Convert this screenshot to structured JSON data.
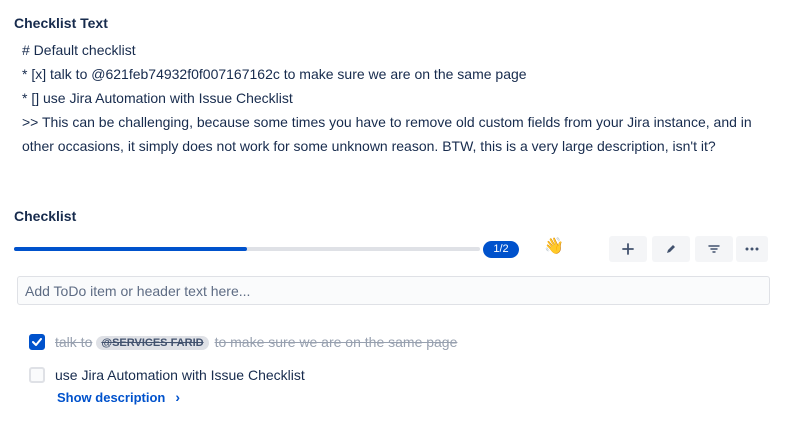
{
  "checklist_text": {
    "title": "Checklist Text",
    "lines": [
      "# Default checklist",
      "* [x] talk to @621feb74932f0f007167162c to make sure we are on the same page",
      "* [] use Jira Automation with Issue Checklist",
      ">> This can be challenging, because some times you have to remove old custom fields from your Jira instance, and in other occasions, it simply does not work for some unknown reason. BTW, this is a very large description, isn't it?"
    ]
  },
  "checklist": {
    "title": "Checklist",
    "progress_label": "1/2",
    "progress_fraction": 0.5,
    "wave_icon": "👋",
    "toolbar": {
      "add_icon": "plus-icon",
      "edit_icon": "pencil-icon",
      "filter_icon": "filter-icon",
      "more_icon": "more-icon"
    },
    "add_input_placeholder": "Add ToDo item or header text here...",
    "items": [
      {
        "checked": true,
        "text_before": "talk to",
        "mention": "@SERVICES FARID",
        "text_after": "to make sure we are on the same page"
      },
      {
        "checked": false,
        "text": "use Jira Automation with Issue Checklist",
        "show_description": "Show description"
      }
    ]
  },
  "colors": {
    "accent": "#0052cc",
    "text": "#172b4d",
    "muted": "#97a0af"
  }
}
